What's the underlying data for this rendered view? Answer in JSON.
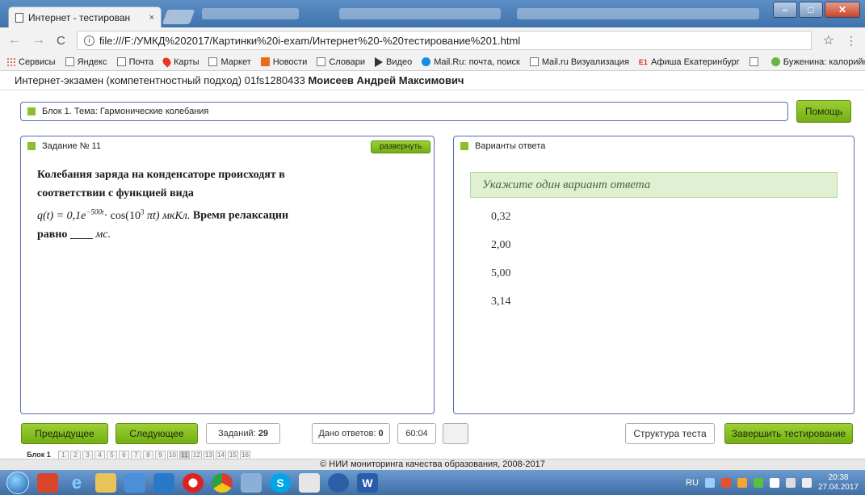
{
  "browser": {
    "tab_title": "Интернет - тестирован",
    "tab_close": "×",
    "url": "file:///F:/УМКД%202017/Картинки%20i-exam/Интернет%20-%20тестирование%201.html",
    "window_buttons": [
      "–",
      "□",
      "✕"
    ],
    "bookmarks": [
      {
        "label": "Сервисы",
        "icon": "apps-icon"
      },
      {
        "label": "Яндекс",
        "icon": "page-icon"
      },
      {
        "label": "Почта",
        "icon": "page-icon"
      },
      {
        "label": "Карты",
        "icon": "map-pin-icon"
      },
      {
        "label": "Маркет",
        "icon": "page-icon"
      },
      {
        "label": "Новости",
        "icon": "news-icon"
      },
      {
        "label": "Словари",
        "icon": "page-icon"
      },
      {
        "label": "Видео",
        "icon": "video-icon"
      },
      {
        "label": "Mail.Ru: почта, поиск",
        "icon": "mailru-icon"
      },
      {
        "label": "Mail.ru Визуализация",
        "icon": "page-icon"
      },
      {
        "label": "Афиша Екатеринбург",
        "icon": "e1-icon"
      },
      {
        "label": "",
        "icon": "page-icon"
      },
      {
        "label": "Буженина: калорийн",
        "icon": "food-icon"
      }
    ],
    "bookmarks_more": "»"
  },
  "header": {
    "exam_title": "Интернет-экзамен (компетентностный подход) 01fs1280433",
    "student": "Моисеев Андрей Максимович"
  },
  "block": {
    "label": "Блок 1. Тема: Гармонические колебания"
  },
  "help_label": "Помощь",
  "task": {
    "title": "Задание № 11",
    "expand_label": "развернуть",
    "text_line1": "Колебания заряда на конденсаторе происходят в",
    "text_line2": "соответствии с функцией вида",
    "formula_q": "q(t) = 0,1e",
    "formula_exp": "−500t",
    "formula_mid": "· cos(10",
    "formula_pow": "3",
    "formula_end": " πt) мкКл.",
    "text_after_formula": " Время релаксации",
    "text_line4": "равно ____ ",
    "text_unit": "мс."
  },
  "answers": {
    "title": "Варианты ответа",
    "prompt": "Укажите один вариант ответа",
    "options": [
      "0,32",
      "2,00",
      "5,00",
      "3,14"
    ]
  },
  "controls": {
    "prev": "Предыдущее",
    "next": "Следующее",
    "tasks_label": "Заданий:",
    "tasks_count": "29",
    "answered_label": "Дано ответов:",
    "answered_count": "0",
    "timer": "60:04",
    "structure": "Структура теста",
    "finish": "Завершить тестирование"
  },
  "pager": {
    "label": "Блок 1",
    "pages": [
      "1",
      "2",
      "3",
      "4",
      "5",
      "6",
      "7",
      "8",
      "9",
      "10",
      "11",
      "12",
      "13",
      "14",
      "15",
      "16"
    ],
    "current": "11"
  },
  "footer": "© НИИ мониторинга качества образования, 2008-2017",
  "taskbar": {
    "lang": "RU",
    "time": "20:38",
    "date": "27.04.2017"
  }
}
